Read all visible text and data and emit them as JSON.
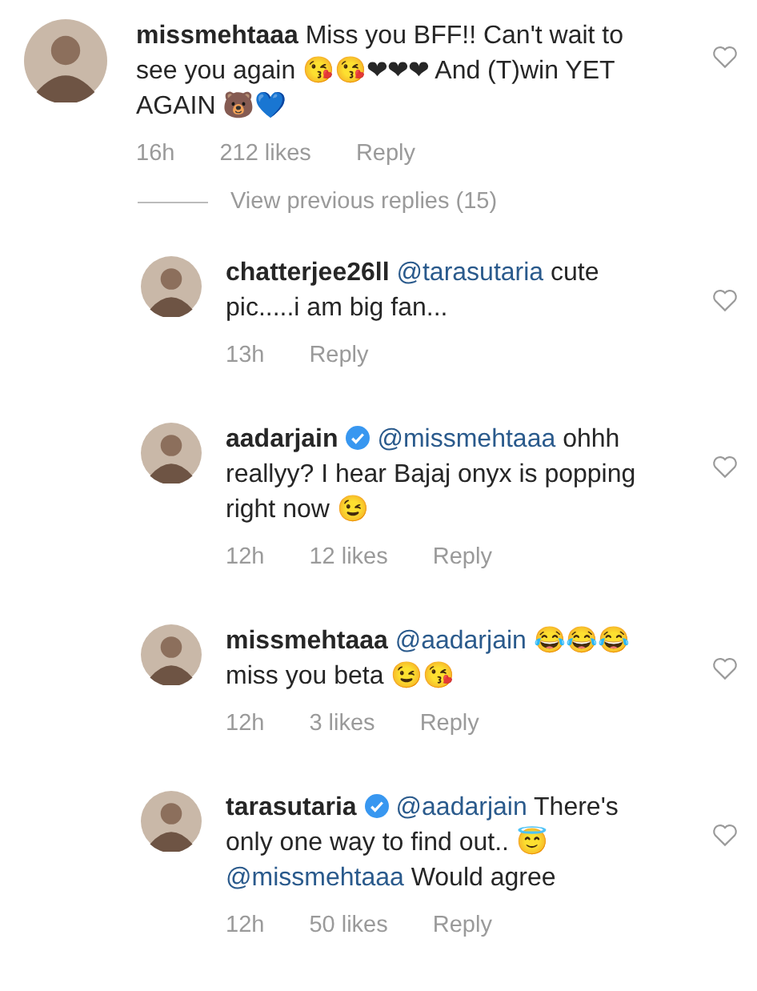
{
  "comment": {
    "username": "missmehtaaa",
    "verified": false,
    "liked": false,
    "body": [
      {
        "kind": "text",
        "text": "Miss you BFF!! Can't wait to see you again 😘😘❤❤❤ And (T)win YET AGAIN 🐻💙"
      }
    ],
    "time": "16h",
    "likes": "212 likes",
    "reply": "Reply"
  },
  "view_replies": "View previous replies (15)",
  "replies": [
    {
      "username": "chatterjee26ll",
      "verified": false,
      "liked": false,
      "body": [
        {
          "kind": "mention",
          "text": "@tarasutaria"
        },
        {
          "kind": "text",
          "text": "cute pic.....i am big fan..."
        }
      ],
      "time": "13h",
      "reply": "Reply"
    },
    {
      "username": "aadarjain",
      "verified": true,
      "liked": false,
      "body": [
        {
          "kind": "mention",
          "text": "@missmehtaaa"
        },
        {
          "kind": "text",
          "text": "ohhh reallyy? I hear Bajaj onyx is popping right now 😉"
        }
      ],
      "time": "12h",
      "likes": "12 likes",
      "reply": "Reply"
    },
    {
      "username": "missmehtaaa",
      "verified": false,
      "liked": false,
      "body": [
        {
          "kind": "mention",
          "text": "@aadarjain"
        },
        {
          "kind": "text",
          "text": "😂😂😂 miss you beta 😉😘"
        }
      ],
      "time": "12h",
      "likes": "3 likes",
      "reply": "Reply"
    },
    {
      "username": "tarasutaria",
      "verified": true,
      "liked": false,
      "body": [
        {
          "kind": "mention",
          "text": "@aadarjain"
        },
        {
          "kind": "text",
          "text": "There's only one way to find out.. 😇"
        },
        {
          "kind": "mention",
          "text": "@missmehtaaa"
        },
        {
          "kind": "text",
          "text": "Would agree"
        }
      ],
      "time": "12h",
      "likes": "50 likes",
      "reply": "Reply"
    }
  ]
}
